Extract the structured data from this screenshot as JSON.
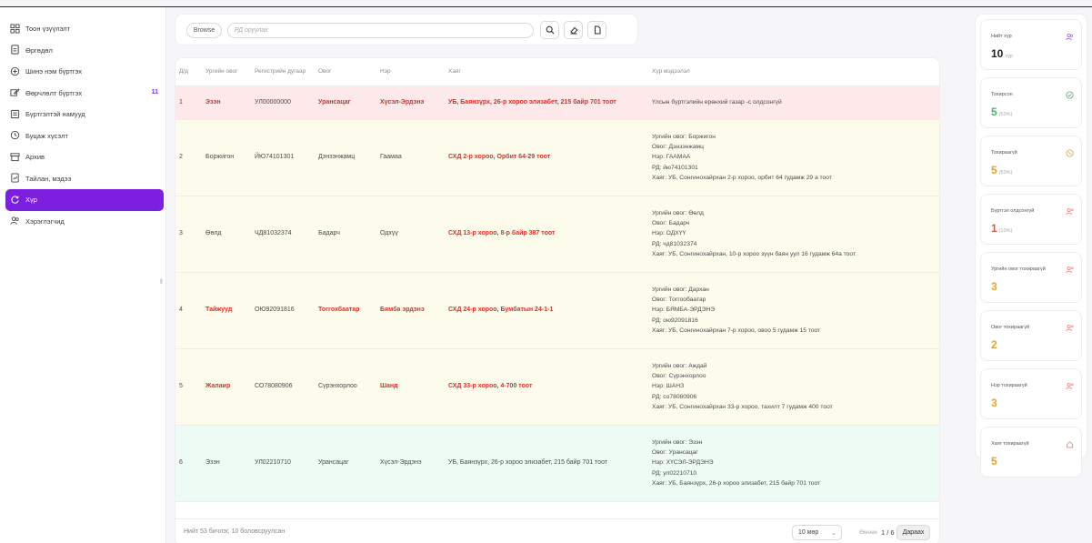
{
  "sidebar": {
    "items": [
      {
        "label": "Тоон үзүүлэлт",
        "icon": "dashboard-grid-icon"
      },
      {
        "label": "Өргөдөл",
        "icon": "document-icon"
      },
      {
        "label": "Шинэ нэм бүртгэх",
        "icon": "add-circle-icon"
      },
      {
        "label": "Өөрчлөлт бүртгэх",
        "icon": "edit-group-icon",
        "badge": "11"
      },
      {
        "label": "Бүртгэлтэй намууд",
        "icon": "list-icon"
      },
      {
        "label": "Буцаж хүсэлт",
        "icon": "clock-icon"
      },
      {
        "label": "Архив",
        "icon": "archive-icon"
      },
      {
        "label": "Тайлан, мэдээ",
        "icon": "report-icon"
      },
      {
        "label": "Хүр",
        "icon": "refresh-icon",
        "active": true
      },
      {
        "label": "Хэрэглэгчид",
        "icon": "users-icon"
      }
    ],
    "collapse_glyph": "‖"
  },
  "toolbar": {
    "browse_label": "Browse",
    "search_placeholder": "РД оруулах"
  },
  "table": {
    "headers": [
      "Д/д",
      "Ургийн овог",
      "Регистрийн дугаар",
      "Овог",
      "Нэр",
      "Хаяг",
      "Хүр мэдээлэл"
    ],
    "rows": [
      {
        "style": "pink",
        "num": "1",
        "clan": "Эзэн",
        "reg": "УЛ00000000",
        "surname": "Урансацаг",
        "name": "Хүсэл-Эрдэнэ",
        "address": "УБ, Баянзүрх, 26-р хороо элизабет, 215 байр 701 тоот",
        "info": [
          "Үлсын бүртгэлийн ерөнхий газар -с олдсонгүй"
        ],
        "red": [
          "clan",
          "surname",
          "name",
          "address"
        ]
      },
      {
        "style": "yellow",
        "num": "2",
        "clan": "Боржигон",
        "reg": "ЙЮ74101301",
        "surname": "Дэнзэнжамц",
        "name": "Гаамаа",
        "address": "СХД 2-р хороо, Орбит 64-29 тоот",
        "info": [
          "Ургийн овог: Боржигон",
          "Овог: Дэнзэнжамц",
          "Нэр: ГААМАА",
          "РД: йю74101301",
          "Хаяг: УБ, Сонгинохайрхан 2-р хороо, орбит 64 гудамж 29 а тоот"
        ],
        "red": [
          "address"
        ]
      },
      {
        "style": "yellow",
        "num": "3",
        "clan": "Өөлд",
        "reg": "ЧД81032374",
        "surname": "Бадарч",
        "name": "Одхүү",
        "address": "СХД 13-р хороо, 8-р байр 387 тоот",
        "info": [
          "Ургийн овог: Өөлд",
          "Овог: Бадарч",
          "Нэр: ОДХҮҮ",
          "РД: чд81032374",
          "Хаяг: УБ, Сонгинохайрхан, 10-р хороо зүүн баян уул 16 гудамж 64а тоот"
        ],
        "red": [
          "address"
        ]
      },
      {
        "style": "yellow",
        "num": "4",
        "clan": "Тайжууд",
        "reg": "ОЮ92091816",
        "surname": "Тоггохбаатар",
        "name": "Бямба эрдэнэ",
        "address": "СХД 24-р хороо, Бумбатын 24-1-1",
        "info": [
          "Ургийн овог: Дархан",
          "Овог: Тоггообаатар",
          "Нэр: БЯМБА-ЭРДЭНЭ",
          "РД: ою92091816",
          "Хаяг: УБ, Сонгинохайрхан 7-р хороо, овоо 5 гудамж 15 тоот"
        ],
        "red": [
          "clan",
          "surname",
          "name",
          "address"
        ]
      },
      {
        "style": "yellow",
        "num": "5",
        "clan": "Жалаир",
        "reg": "СО78080906",
        "surname": "Сүрэнхорлоо",
        "name": "Шанд",
        "address": "СХД 33-р хороо, 4-700 тоот",
        "info": [
          "Ургийн овог: Аждай",
          "Овог: Сүрэнхорлоо",
          "Нэр: ШАНЗ",
          "РД: со78080906",
          "Хаяг: УБ, Сонгинохайрхан 33-р хороо, тахилт 7 гудамж 400 тоот"
        ],
        "red": [
          "clan",
          "name",
          "address"
        ]
      },
      {
        "style": "green",
        "num": "6",
        "clan": "Эзэн",
        "reg": "УЛ02210710",
        "surname": "Урансацаг",
        "name": "Хүсэл-Эрдэнэ",
        "address": "УБ, Баянзүрх, 26-р хороо элизабет, 215 байр 701 тоот",
        "info": [
          "Ургийн овог: Эзэн",
          "Овог: Урансацаг",
          "Нэр: ХҮСЭЛ-ЭРДЭНЭ",
          "РД: ул02210710",
          "Хаяг: УБ, Баянзүрх, 26-р хороо элизабет, 215 байр 701 тоот"
        ],
        "red": []
      }
    ]
  },
  "footer": {
    "summary": "Нийт 53 бичлэг, 10 боловсруулсан",
    "per_page": "10 мөр",
    "prev_label": "Өмнөх",
    "page_indicator": "1 / 6",
    "next_label": "Дараах"
  },
  "stats": [
    {
      "label": "Нийт хүр",
      "value": "10",
      "unit": "хүр",
      "color": "#222222",
      "icon_color": "#a35fe0",
      "icon": "users-icon"
    },
    {
      "label": "Тохирсон",
      "value": "5",
      "unit": "(50%)",
      "color": "#3dbb6b",
      "icon_color": "#3dbb6b",
      "icon": "check-circle-icon"
    },
    {
      "label": "Тохираагүй",
      "value": "5",
      "unit": "(50%)",
      "color": "#e8a32e",
      "icon_color": "#e8a32e",
      "icon": "warning-circle-icon"
    },
    {
      "label": "Бүртгэл олдсонгүй",
      "value": "1",
      "unit": "(10%)",
      "color": "#e4573f",
      "icon_color": "#e8846e",
      "icon": "user-x-icon"
    },
    {
      "label": "Ургийн овог тохираагүй",
      "value": "3",
      "unit": "",
      "color": "#e8a32e",
      "icon_color": "#e8846e",
      "icon": "user-x-icon"
    },
    {
      "label": "Овог тохираагүй",
      "value": "2",
      "unit": "",
      "color": "#e8a32e",
      "icon_color": "#e8846e",
      "icon": "user-x-icon"
    },
    {
      "label": "Нэр тохираагүй",
      "value": "3",
      "unit": "",
      "color": "#e8a32e",
      "icon_color": "#e8846e",
      "icon": "user-x-icon"
    },
    {
      "label": "Хаяг тохираагүй",
      "value": "5",
      "unit": "",
      "color": "#e8a32e",
      "icon_color": "#e8846e",
      "icon": "home-icon"
    }
  ]
}
